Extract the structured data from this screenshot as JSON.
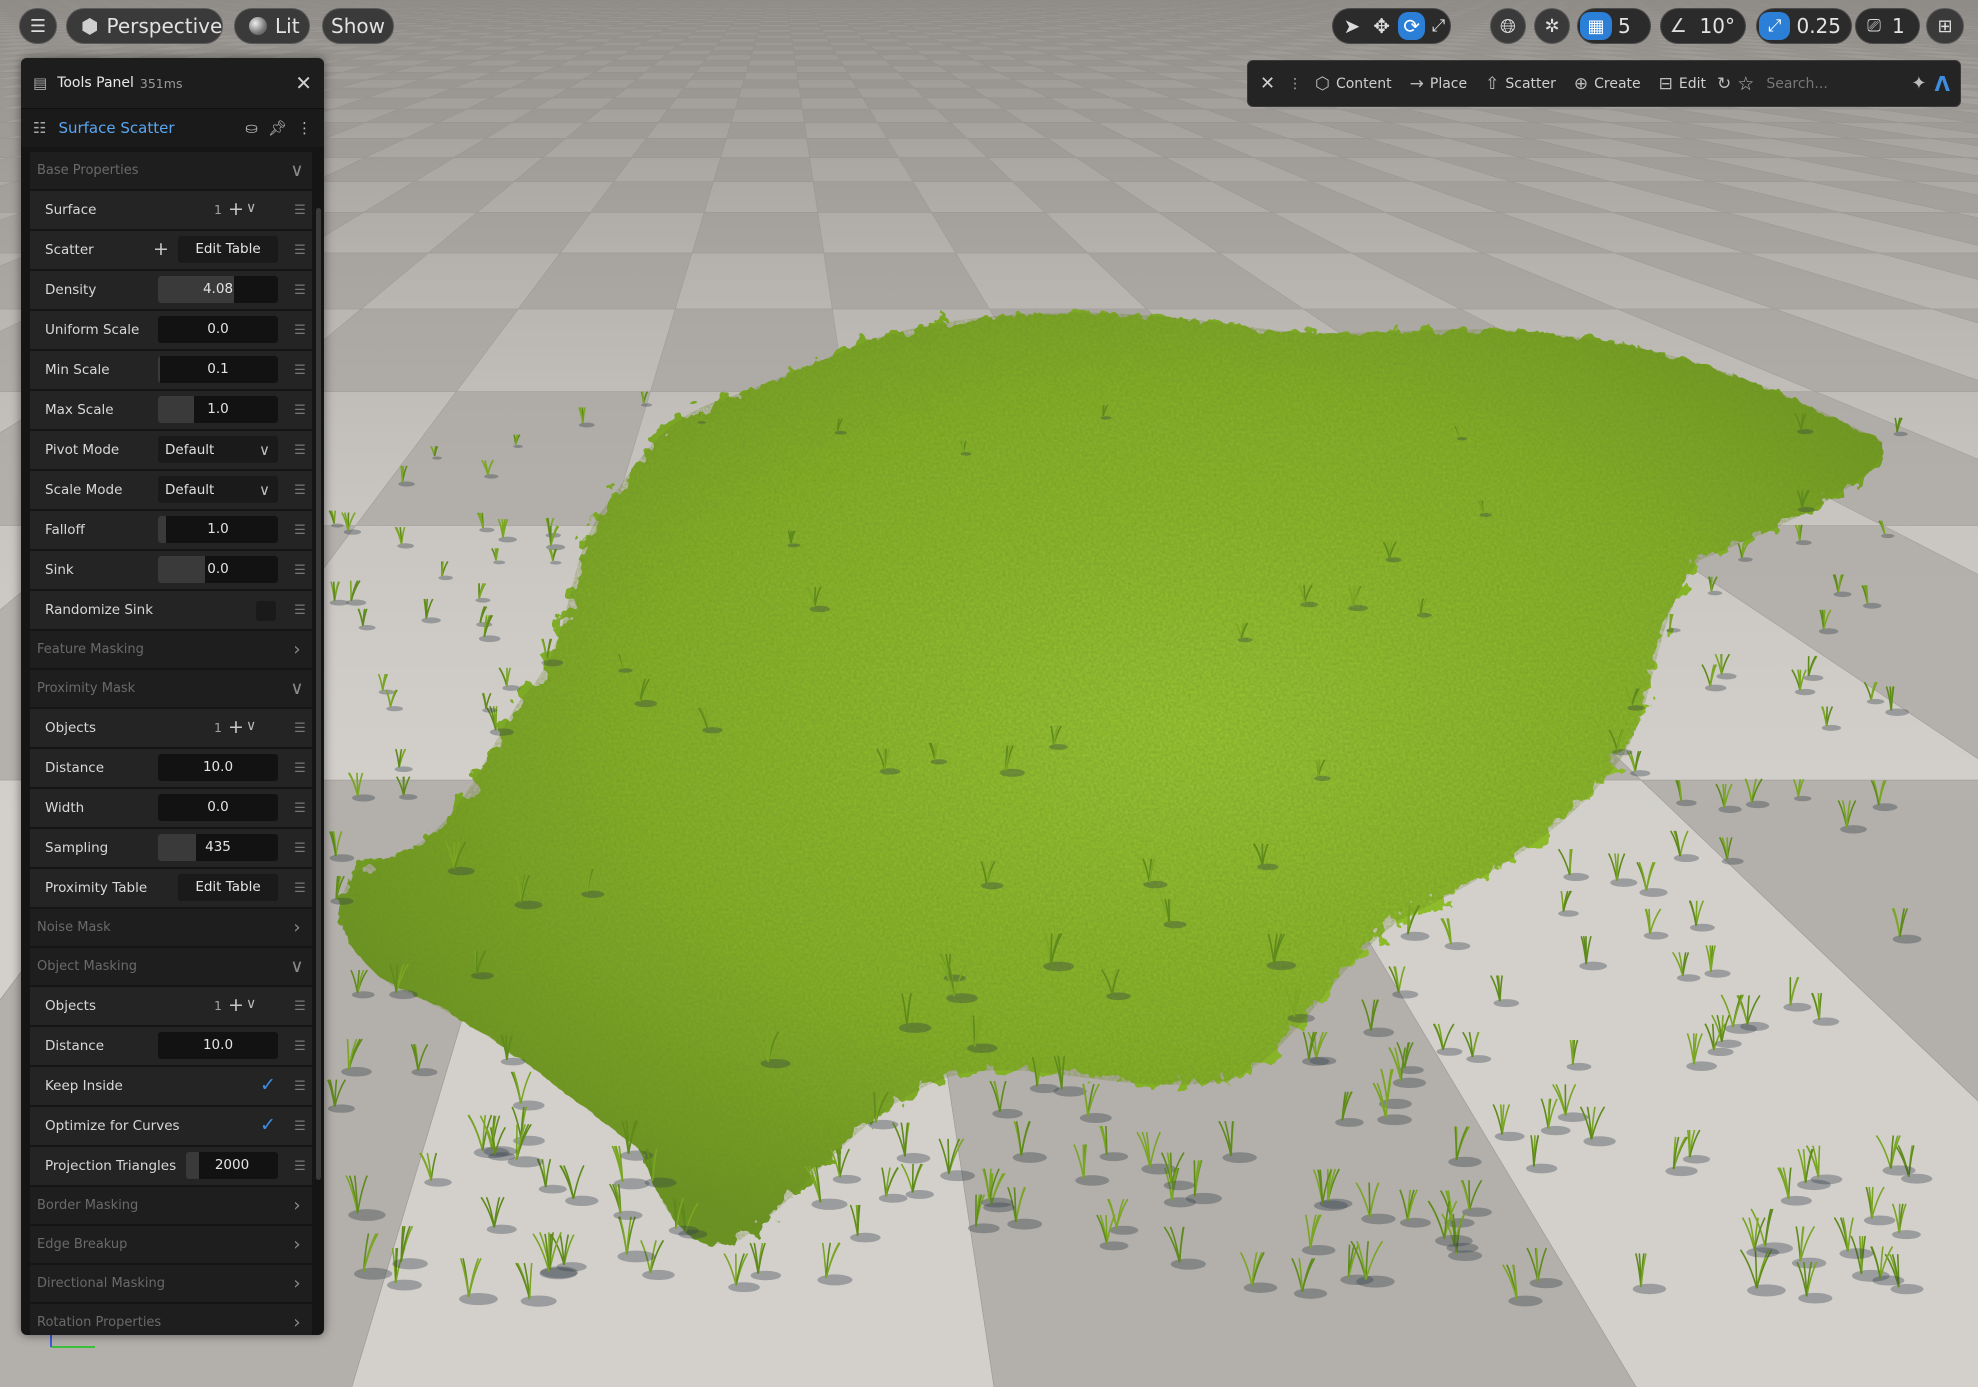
{
  "viewport": {
    "mode_label": "Perspective",
    "lighting_label": "Lit",
    "show_label": "Show",
    "grid_snap_value": "5",
    "angle_snap_value": "10°",
    "scale_snap_value": "0.25",
    "camera_speed_value": "1"
  },
  "modebar": {
    "items": [
      "Content",
      "Place",
      "Scatter",
      "Create",
      "Edit"
    ],
    "search_placeholder": "Search..."
  },
  "tools_panel": {
    "title": "Tools Panel",
    "time": "351ms",
    "tool_name": "Surface Scatter",
    "sections": {
      "base_properties": "Base Properties",
      "feature_masking": "Feature Masking",
      "proximity_mask": "Proximity Mask",
      "noise_mask": "Noise Mask",
      "object_masking": "Object Masking",
      "border_masking": "Border Masking",
      "edge_breakup": "Edge Breakup",
      "directional_masking": "Directional Masking",
      "rotation_properties": "Rotation Properties"
    },
    "rows": {
      "surface": {
        "label": "Surface",
        "count": "1"
      },
      "scatter": {
        "label": "Scatter",
        "button": "Edit Table"
      },
      "density": {
        "label": "Density",
        "value": "4.08",
        "fill": 0.63
      },
      "uniform_scale": {
        "label": "Uniform Scale",
        "value": "0.0",
        "fill": 0
      },
      "min_scale": {
        "label": "Min Scale",
        "value": "0.1",
        "fill": 0.02
      },
      "max_scale": {
        "label": "Max Scale",
        "value": "1.0",
        "fill": 0.3
      },
      "pivot_mode": {
        "label": "Pivot Mode",
        "value": "Default"
      },
      "scale_mode": {
        "label": "Scale Mode",
        "value": "Default"
      },
      "falloff": {
        "label": "Falloff",
        "value": "1.0",
        "fill": 0.07
      },
      "sink": {
        "label": "Sink",
        "value": "0.0",
        "fill": 0.39
      },
      "randomize_sink": {
        "label": "Randomize Sink"
      },
      "objects_1": {
        "label": "Objects",
        "count": "1"
      },
      "distance_1": {
        "label": "Distance",
        "value": "10.0",
        "fill": 0
      },
      "width": {
        "label": "Width",
        "value": "0.0",
        "fill": 0
      },
      "sampling": {
        "label": "Sampling",
        "value": "435",
        "fill": 0.32
      },
      "proximity_table": {
        "label": "Proximity Table",
        "button": "Edit Table"
      },
      "objects_2": {
        "label": "Objects",
        "count": "1"
      },
      "distance_2": {
        "label": "Distance",
        "value": "10.0",
        "fill": 0
      },
      "keep_inside": {
        "label": "Keep Inside",
        "checked": true
      },
      "optimize_curves": {
        "label": "Optimize for Curves",
        "checked": true
      },
      "projection_triangles": {
        "label": "Projection Triangles",
        "value": "2000",
        "fill": 0.14
      }
    }
  },
  "colors": {
    "accent": "#2b7fd6",
    "tool_name": "#5aa6f0",
    "grass": "#8fbf2a",
    "floor_light": "#d3d0cc",
    "floor_dark": "#b3afab"
  }
}
